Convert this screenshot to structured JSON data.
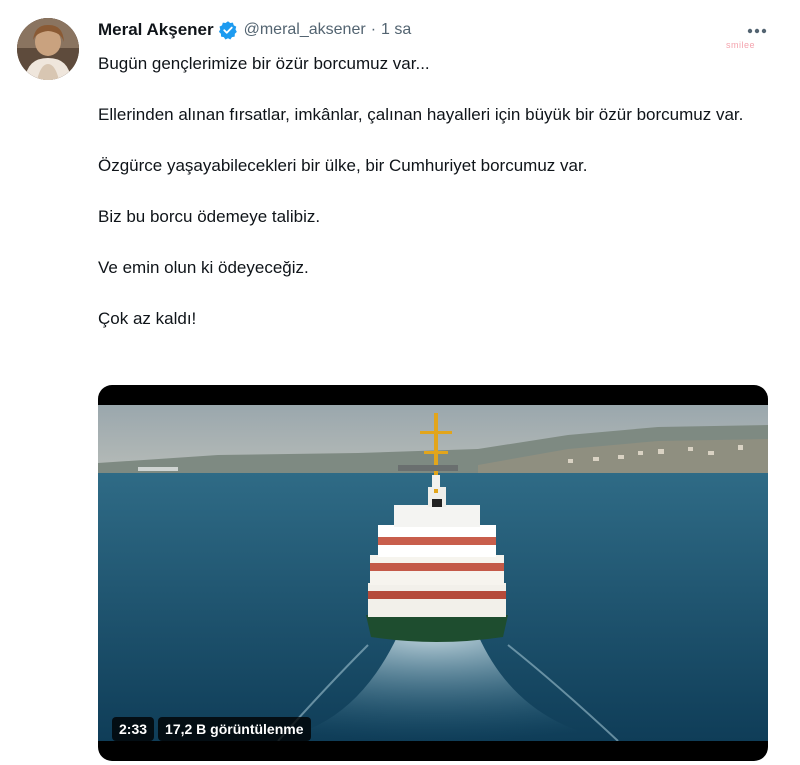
{
  "author": {
    "name": "Meral Akşener",
    "handle": "@meral_aksener",
    "separator": "·",
    "time": "1 sa",
    "verified_color": "#1d9bf0"
  },
  "tweet": {
    "paragraphs": [
      "Bugün gençlerimize bir özür borcumuz var...",
      "Ellerinden alınan fırsatlar, imkânlar, çalınan hayalleri için büyük bir özür borcumuz var.",
      "Özgürce yaşayabilecekleri bir ülke, bir Cumhuriyet borcumuz var.",
      "Biz bu borcu ödemeye talibiz.",
      "Ve emin olun ki ödeyeceğiz.",
      "Çok az kaldı!"
    ]
  },
  "watermark": "smilee",
  "video": {
    "duration": "2:33",
    "views": "17,2 B görüntülenme"
  },
  "icons": {
    "more": "more-icon",
    "verified": "verified-badge-icon",
    "avatar": "avatar"
  }
}
